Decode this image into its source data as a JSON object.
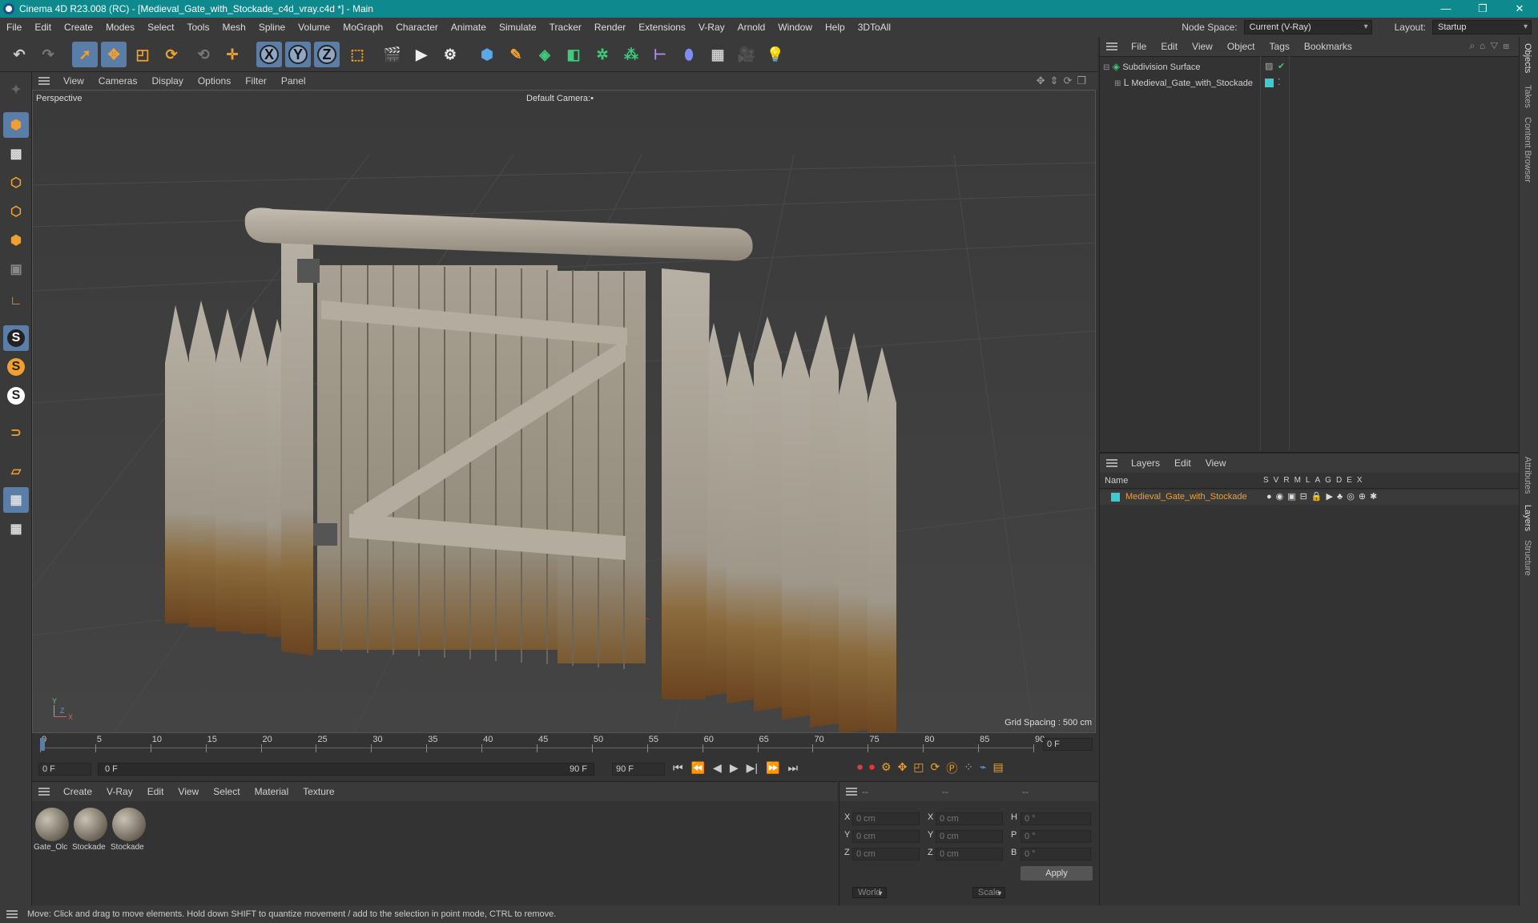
{
  "window": {
    "title": "Cinema 4D R23.008 (RC) - [Medieval_Gate_with_Stockade_c4d_vray.c4d *] - Main",
    "controls": [
      "—",
      "❐",
      "✕"
    ]
  },
  "menubar": {
    "items": [
      "File",
      "Edit",
      "Create",
      "Modes",
      "Select",
      "Tools",
      "Mesh",
      "Spline",
      "Volume",
      "MoGraph",
      "Character",
      "Animate",
      "Simulate",
      "Tracker",
      "Render",
      "Extensions",
      "V-Ray",
      "Arnold",
      "Window",
      "Help",
      "3DToAll"
    ],
    "node_space_label": "Node Space:",
    "node_space_value": "Current (V-Ray)",
    "layout_label": "Layout:",
    "layout_value": "Startup"
  },
  "toolbar": {
    "axis_x": "X",
    "axis_y": "Y",
    "axis_z": "Z"
  },
  "lefttools": {
    "snap1": "S",
    "snap2": "S",
    "snap3": "S"
  },
  "viewport": {
    "menu": [
      "View",
      "Cameras",
      "Display",
      "Options",
      "Filter",
      "Panel"
    ],
    "label": "Perspective",
    "camera": "Default Camera",
    "camera_suffix": ":•",
    "grid_spacing": "Grid Spacing : 500 cm",
    "axis_y": "Y",
    "axis_z": "Z",
    "axis_x": "X"
  },
  "timeline": {
    "ticks": [
      "0",
      "5",
      "10",
      "15",
      "20",
      "25",
      "30",
      "35",
      "40",
      "45",
      "50",
      "55",
      "60",
      "65",
      "70",
      "75",
      "80",
      "85",
      "90"
    ],
    "current_frame": "0 F",
    "start_field": "0 F",
    "range_start": "0 F",
    "range_end": "90 F",
    "end_field": "90 F"
  },
  "materials": {
    "menu": [
      "Create",
      "V-Ray",
      "Edit",
      "View",
      "Select",
      "Material",
      "Texture"
    ],
    "items": [
      {
        "name": "Gate_Olc"
      },
      {
        "name": "Stockade"
      },
      {
        "name": "Stockade"
      }
    ]
  },
  "coords": {
    "headers": [
      "--",
      "--",
      "--"
    ],
    "rows": [
      {
        "a": "X",
        "av": "0 cm",
        "b": "X",
        "bv": "0 cm",
        "c": "H",
        "cv": "0 °"
      },
      {
        "a": "Y",
        "av": "0 cm",
        "b": "Y",
        "bv": "0 cm",
        "c": "P",
        "cv": "0 °"
      },
      {
        "a": "Z",
        "av": "0 cm",
        "b": "Z",
        "bv": "0 cm",
        "c": "B",
        "cv": "0 °"
      }
    ],
    "mode1": "World",
    "mode2": "Scale",
    "apply": "Apply"
  },
  "objects": {
    "menu": [
      "File",
      "Edit",
      "View",
      "Object",
      "Tags",
      "Bookmarks"
    ],
    "tree": [
      {
        "name": "Subdivision Surface"
      },
      {
        "name": "Medieval_Gate_with_Stockade"
      }
    ]
  },
  "layers": {
    "menu": [
      "Layers",
      "Edit",
      "View"
    ],
    "col_name": "Name",
    "cols": [
      "S",
      "V",
      "R",
      "M",
      "L",
      "A",
      "G",
      "D",
      "E",
      "X"
    ],
    "rows": [
      {
        "name": "Medieval_Gate_with_Stockade",
        "color": "#3ecbd0"
      }
    ]
  },
  "rightstrip": {
    "tabs_top": [
      "Objects",
      "Takes",
      "Content Browser"
    ],
    "tabs_bottom": [
      "Attributes",
      "Layers",
      "Structure"
    ]
  },
  "status": {
    "text": "Move: Click and drag to move elements. Hold down SHIFT to quantize movement / add to the selection in point mode, CTRL to remove."
  },
  "colors": {
    "titlebar": "#0e8a8e",
    "active_tool": "#5b7ea8",
    "layer_name": "#f0a030",
    "layer_swatch": "#3ecbd0"
  }
}
